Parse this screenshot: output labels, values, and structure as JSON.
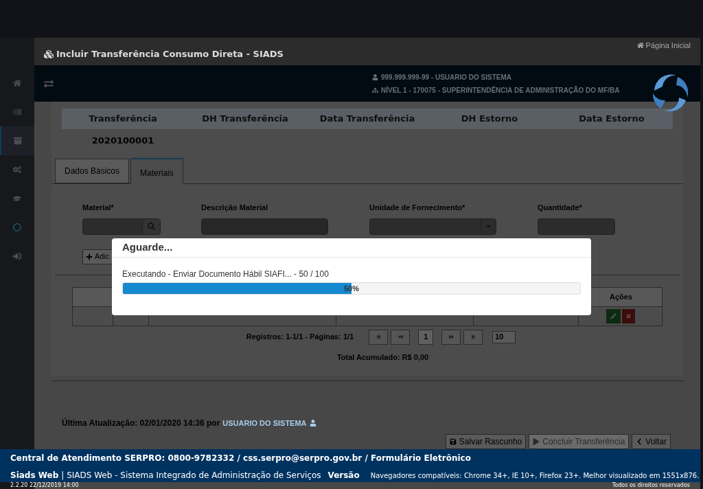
{
  "top_link": "Página Inicial",
  "page_title": "Incluir Transferência Consumo Direta - SIADS",
  "header": {
    "user": "999.999.999-99 - USUARIO DO SISTEMA",
    "level": "NÍVEL 1 - 170075 - SUPERINTENDÊNCIA DE ADMINISTRAÇÃO DO MF/BA"
  },
  "sidebar": {
    "items": [
      {
        "kind": "home",
        "selected": false
      },
      {
        "kind": "barcode",
        "selected": false
      },
      {
        "kind": "archive",
        "selected": true
      },
      {
        "kind": "cogs",
        "selected": false
      },
      {
        "kind": "cap",
        "selected": false
      },
      {
        "kind": "circle",
        "selected": false
      },
      {
        "kind": "signin",
        "selected": false
      }
    ]
  },
  "summary": {
    "columns": [
      "Transferência",
      "DH Transferência",
      "Data Transferência",
      "DH Estorno",
      "Data Estorno"
    ],
    "values": [
      "2020100001"
    ]
  },
  "tabs": [
    {
      "label": "Dados Básicos",
      "selected": false
    },
    {
      "label": "Materiais",
      "selected": true
    }
  ],
  "fields": [
    {
      "label": "Material*",
      "kind": "search"
    },
    {
      "label": "Descrição Material",
      "kind": "readonly"
    },
    {
      "label": "Unidade de Fornecimento*",
      "kind": "select"
    },
    {
      "label": "Quantidade*",
      "kind": "text"
    }
  ],
  "add_button": "Adic",
  "materials_table": {
    "columns": [
      "Ações"
    ]
  },
  "pagination": {
    "summary": "Registros: 1-1/1 - Páginas: 1/1",
    "page": "1",
    "page_size": "10"
  },
  "total": "Total Acumulado: R$ 0,00",
  "last_update": {
    "text": "Última Atualização: 02/01/2020 14:36 por",
    "user": "USUARIO DO SISTEMA"
  },
  "actions": [
    {
      "label": "Salvar Rascunho",
      "kind": "save",
      "disabled": false
    },
    {
      "label": "Concluir Transferência",
      "kind": "play",
      "disabled": true
    },
    {
      "label": "Voltar",
      "kind": "back",
      "disabled": false
    }
  ],
  "footer": {
    "contact": "Central de Atendimento SERPRO: 0800-9782332 / css.serpro@serpro.gov.br / Formulário Eletrônico",
    "brand": "Siads Web",
    "system": "| SIADS Web - Sistema Integrado de Administração de Serviços",
    "version_label": "Versão",
    "browsers": "Navegadores compatíveis: Chrome 34+, IE 10+, Firefox 23+. Melhor visualizado em 1551x876.",
    "version": "2.2.20 22/12/2019 14:00",
    "rights": "Todos os direitos reservados"
  },
  "modal": {
    "title": "Aguarde...",
    "message": "Executando - Enviar Documento Hábil SIAFI... - 50 / 100",
    "level": 0.5,
    "progress_label": "50%"
  }
}
